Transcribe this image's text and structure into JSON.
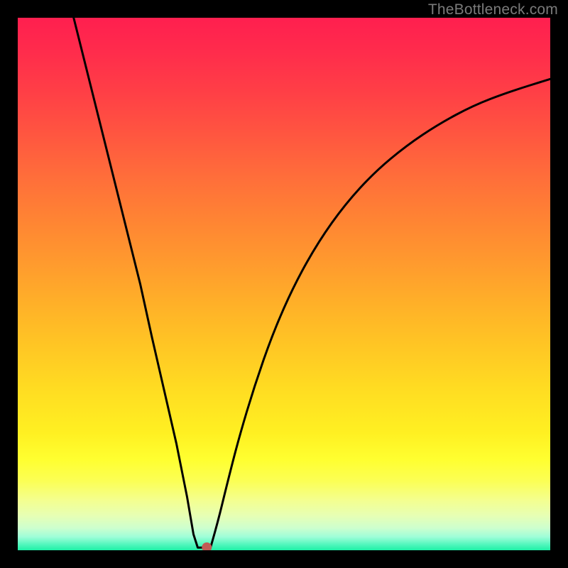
{
  "watermark": "TheBottleneck.com",
  "colors": {
    "frame": "#000000",
    "curve": "#000000",
    "marker": "#c15a55"
  },
  "gradient_stops": [
    {
      "offset": 0.0,
      "color": "#ff1f4f"
    },
    {
      "offset": 0.06,
      "color": "#ff2b4c"
    },
    {
      "offset": 0.14,
      "color": "#ff3f46"
    },
    {
      "offset": 0.22,
      "color": "#ff5640"
    },
    {
      "offset": 0.3,
      "color": "#ff6e3a"
    },
    {
      "offset": 0.38,
      "color": "#ff8433"
    },
    {
      "offset": 0.46,
      "color": "#ff9a2e"
    },
    {
      "offset": 0.54,
      "color": "#ffb128"
    },
    {
      "offset": 0.62,
      "color": "#ffc724"
    },
    {
      "offset": 0.7,
      "color": "#ffdd22"
    },
    {
      "offset": 0.78,
      "color": "#fff022"
    },
    {
      "offset": 0.83,
      "color": "#ffff30"
    },
    {
      "offset": 0.87,
      "color": "#fbff55"
    },
    {
      "offset": 0.905,
      "color": "#f4ff8e"
    },
    {
      "offset": 0.935,
      "color": "#e7ffb4"
    },
    {
      "offset": 0.958,
      "color": "#cdffce"
    },
    {
      "offset": 0.975,
      "color": "#9efed8"
    },
    {
      "offset": 0.99,
      "color": "#4ef6bb"
    },
    {
      "offset": 1.0,
      "color": "#1ef0a6"
    }
  ],
  "chart_data": {
    "type": "line",
    "title": "",
    "xlabel": "",
    "ylabel": "",
    "x_range": [
      0,
      100
    ],
    "y_range": [
      0,
      100
    ],
    "marker": {
      "x": 35.5,
      "y": 0
    },
    "left": {
      "description": "steep near-linear drop from top-left down to the trough",
      "points": [
        {
          "x": 10.5,
          "y": 100
        },
        {
          "x": 13.0,
          "y": 90
        },
        {
          "x": 15.5,
          "y": 80
        },
        {
          "x": 18.0,
          "y": 70
        },
        {
          "x": 20.5,
          "y": 60
        },
        {
          "x": 23.0,
          "y": 50
        },
        {
          "x": 25.2,
          "y": 40
        },
        {
          "x": 27.5,
          "y": 30
        },
        {
          "x": 29.8,
          "y": 20
        },
        {
          "x": 31.8,
          "y": 10
        },
        {
          "x": 33.0,
          "y": 3
        },
        {
          "x": 33.8,
          "y": 0.5
        }
      ]
    },
    "trough": {
      "description": "short flat bottom segment",
      "points": [
        {
          "x": 33.8,
          "y": 0.5
        },
        {
          "x": 36.2,
          "y": 0.5
        }
      ]
    },
    "right": {
      "description": "rising concave curve flattening toward the right edge",
      "points": [
        {
          "x": 36.2,
          "y": 0.5
        },
        {
          "x": 37.5,
          "y": 5
        },
        {
          "x": 39.2,
          "y": 12
        },
        {
          "x": 41.5,
          "y": 21
        },
        {
          "x": 44.5,
          "y": 31
        },
        {
          "x": 48.0,
          "y": 41
        },
        {
          "x": 52.0,
          "y": 50
        },
        {
          "x": 56.5,
          "y": 58
        },
        {
          "x": 61.5,
          "y": 65
        },
        {
          "x": 67.0,
          "y": 71
        },
        {
          "x": 73.0,
          "y": 76
        },
        {
          "x": 79.0,
          "y": 80
        },
        {
          "x": 85.5,
          "y": 83.5
        },
        {
          "x": 92.0,
          "y": 86
        },
        {
          "x": 100.0,
          "y": 88.5
        }
      ]
    }
  }
}
